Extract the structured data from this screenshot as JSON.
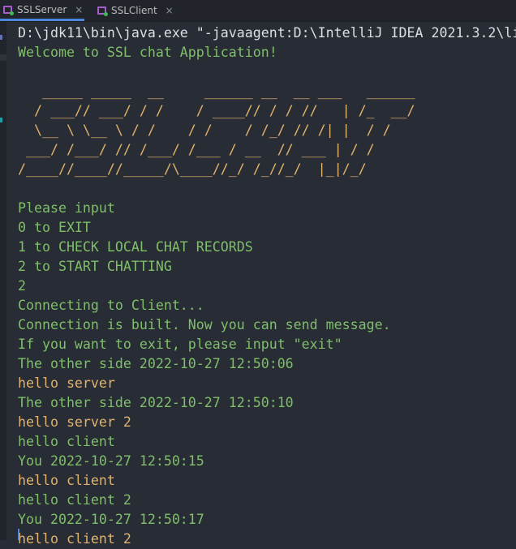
{
  "tabs": [
    {
      "label": "SSLServer",
      "active": true
    },
    {
      "label": "SSLClient",
      "active": false
    }
  ],
  "close_glyph": "×",
  "colors": {
    "background": "#282c34",
    "system": "#dcdfe4",
    "output": "#7fbf6a",
    "input": "#e2b36e",
    "accent": "#4a88e0"
  },
  "console_lines": [
    {
      "text": "D:\\jdk11\\bin\\java.exe \"-javaagent:D:\\IntelliJ IDEA 2021.3.2\\li",
      "kind": "w"
    },
    {
      "text": "Welcome to SSL chat Application!",
      "kind": "g"
    },
    {
      "text": "",
      "kind": "o"
    },
    {
      "text": "   _____ _____  __     ______ __  __ ___   ______",
      "kind": "o"
    },
    {
      "text": "  / ___// ___/ / /    / ____// / / //   | /_  __/",
      "kind": "o"
    },
    {
      "text": "  \\__ \\ \\__ \\ / /    / /    / /_/ // /| |  / /",
      "kind": "o"
    },
    {
      "text": " ___/ /___/ // /___/ /___ / __  // ___ | / /",
      "kind": "o"
    },
    {
      "text": "/____//____//_____/\\____//_/ /_//_/  |_|/_/",
      "kind": "o"
    },
    {
      "text": "",
      "kind": "o"
    },
    {
      "text": "Please input",
      "kind": "g"
    },
    {
      "text": "0 to EXIT",
      "kind": "g"
    },
    {
      "text": "1 to CHECK LOCAL CHAT RECORDS",
      "kind": "g"
    },
    {
      "text": "2 to START CHATTING",
      "kind": "g"
    },
    {
      "text": "2",
      "kind": "g"
    },
    {
      "text": "Connecting to Client...",
      "kind": "g"
    },
    {
      "text": "Connection is built. Now you can send message.",
      "kind": "g"
    },
    {
      "text": "If you want to exit, please input \"exit\"",
      "kind": "g"
    },
    {
      "text": "The other side 2022-10-27 12:50:06",
      "kind": "g"
    },
    {
      "text": "hello server",
      "kind": "o"
    },
    {
      "text": "The other side 2022-10-27 12:50:10",
      "kind": "g"
    },
    {
      "text": "hello server 2",
      "kind": "o"
    },
    {
      "text": "hello client",
      "kind": "g"
    },
    {
      "text": "You 2022-10-27 12:50:15",
      "kind": "g"
    },
    {
      "text": "hello client",
      "kind": "o"
    },
    {
      "text": "hello client 2",
      "kind": "g"
    },
    {
      "text": "You 2022-10-27 12:50:17",
      "kind": "g"
    },
    {
      "text": "hello client 2",
      "kind": "o"
    }
  ]
}
